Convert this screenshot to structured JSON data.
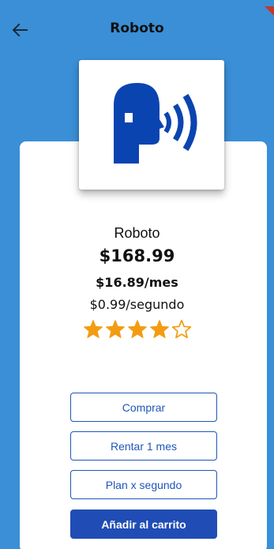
{
  "appbar": {
    "title": "Roboto",
    "back_icon": "arrow-left-icon"
  },
  "product": {
    "logo_icon": "talking-head-icon",
    "name": "Roboto",
    "price": "$168.99",
    "monthly_price": "$16.89/mes",
    "per_second_price": "$0.99/segundo",
    "rating": 4,
    "rating_max": 5
  },
  "actions": {
    "buy_label": "Comprar",
    "rent_label": "Rentar 1 mes",
    "plan_label": "Plan x segundo",
    "cart_label": "Añadir al carrito"
  },
  "colors": {
    "background": "#3a8fd6",
    "brand_blue": "#1f4db5",
    "star": "#f39c12"
  }
}
